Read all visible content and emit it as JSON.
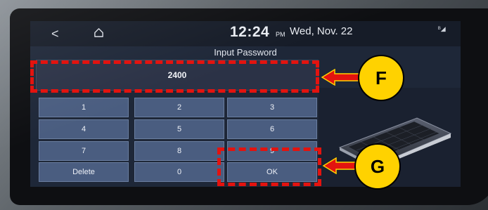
{
  "status": {
    "back_label": "<",
    "time": "12:24",
    "ampm": "PM",
    "date": "Wed, Nov. 22",
    "signal": "ᴮ◢"
  },
  "dialog": {
    "title": "Input Password",
    "password_value": "2400"
  },
  "keypad": {
    "rows": [
      [
        "1",
        "2",
        "3"
      ],
      [
        "4",
        "5",
        "6"
      ],
      [
        "7",
        "8",
        "9"
      ],
      [
        "Delete",
        "0",
        "OK"
      ]
    ]
  },
  "callouts": {
    "f_label": "F",
    "g_label": "G"
  },
  "colors": {
    "callout_red": "#e3130f",
    "badge_yellow": "#ffd200",
    "key_blue": "#4a5d80"
  }
}
